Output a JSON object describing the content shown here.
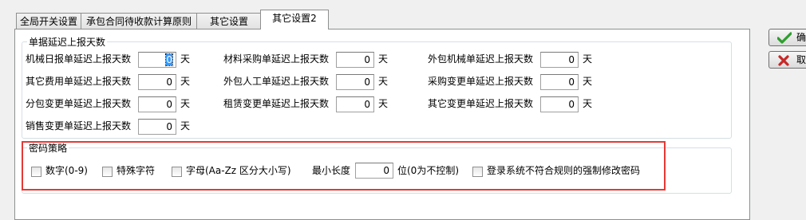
{
  "tabs": [
    {
      "label": "全局开关设置",
      "active": false
    },
    {
      "label": "承包合同待收款计算原则",
      "active": false
    },
    {
      "label": "其它设置",
      "active": false
    },
    {
      "label": "其它设置2",
      "active": true
    }
  ],
  "report_delay": {
    "legend": "单据延迟上报天数",
    "unit": "天",
    "fields": [
      {
        "label": "机械日报单延迟上报天数",
        "value": "0"
      },
      {
        "label": "材料采购单延迟上报天数",
        "value": "0"
      },
      {
        "label": "外包机械单延迟上报天数",
        "value": "0"
      },
      {
        "label": "其它费用单延迟上报天数",
        "value": "0"
      },
      {
        "label": "外包人工单延迟上报天数",
        "value": "0"
      },
      {
        "label": "采购变更单延迟上报天数",
        "value": "0"
      },
      {
        "label": "分包变更单延迟上报天数",
        "value": "0"
      },
      {
        "label": "租赁变更单延迟上报天数",
        "value": "0"
      },
      {
        "label": "其它变更单延迟上报天数",
        "value": "0"
      },
      {
        "label": "销售变更单延迟上报天数",
        "value": "0"
      }
    ]
  },
  "password_policy": {
    "legend": "密码策略",
    "digit": "数字(0-9)",
    "special": "特殊字符",
    "letters": "字母(Aa-Zz  区分大小写)",
    "min_length_label": "最小长度",
    "min_length_value": "0",
    "min_length_suffix": "位(0为不控制)",
    "force_change": "登录系统不符合规则的强制修改密码"
  },
  "buttons": {
    "confirm": "确",
    "cancel": "取"
  },
  "colors": {
    "highlight": "#e53935",
    "confirm_icon": "#2e9e2e",
    "cancel_icon": "#c62828"
  }
}
